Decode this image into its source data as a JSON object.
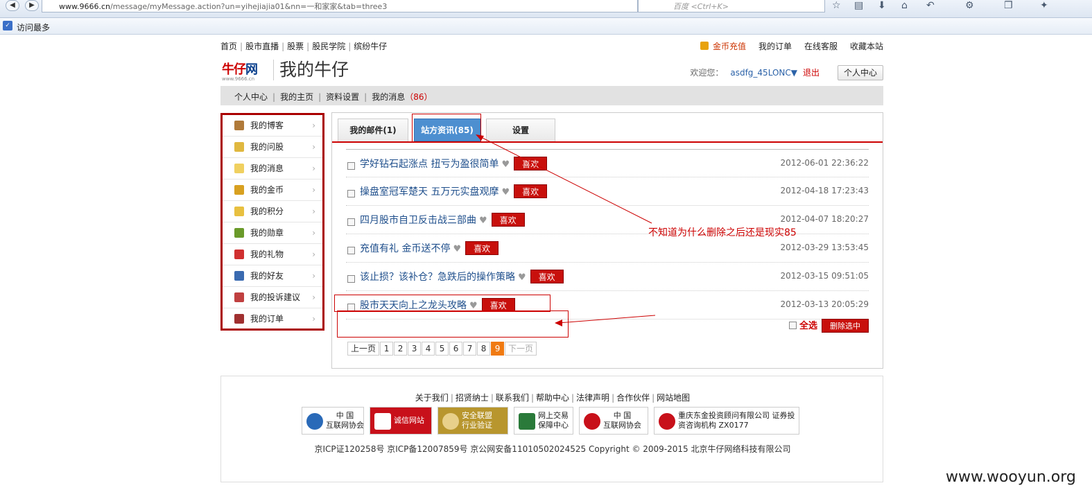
{
  "browser": {
    "url_host": "www.9666.cn",
    "url_rest": "/message/myMessage.action?un=yihejiajia01&nn=一和家家&tab=three3",
    "search_placeholder": "百度 <Ctrl+K>",
    "bookmark": "访问最多"
  },
  "topnav": {
    "left": [
      "首页",
      "股市直播",
      "股票",
      "股民学院",
      "缤纷牛仔"
    ],
    "right": {
      "coin": "金币充值",
      "orders": "我的订单",
      "service": "在线客服",
      "fav": "收藏本站"
    }
  },
  "header": {
    "logo_text_a": "牛仔",
    "logo_text_b": "网",
    "logo_url": "www.9666.cn",
    "title": "我的牛仔",
    "welcome": "欢迎您：",
    "user": "asdfg_45LONC▼",
    "logout": "退出",
    "center_btn": "个人中心"
  },
  "subnav": {
    "items": [
      "个人中心",
      "我的主页",
      "资料设置",
      "我的消息"
    ],
    "msg_count": "（86）"
  },
  "sidebar": {
    "items": [
      {
        "label": "我的博客",
        "icon": "blog-icon",
        "color": "#b07a3a"
      },
      {
        "label": "我的问股",
        "icon": "question-icon",
        "color": "#e0b840"
      },
      {
        "label": "我的消息",
        "icon": "message-icon",
        "color": "#f0d060"
      },
      {
        "label": "我的金币",
        "icon": "coins-icon",
        "color": "#d8a020"
      },
      {
        "label": "我的积分",
        "icon": "points-icon",
        "color": "#e8c040"
      },
      {
        "label": "我的勋章",
        "icon": "medal-icon",
        "color": "#6a9a2a"
      },
      {
        "label": "我的礼物",
        "icon": "gift-icon",
        "color": "#d03030"
      },
      {
        "label": "我的好友",
        "icon": "friends-icon",
        "color": "#3a6ab0"
      },
      {
        "label": "我的投诉建议",
        "icon": "complaint-icon",
        "color": "#c04040"
      },
      {
        "label": "我的订单",
        "icon": "order-icon",
        "color": "#a03030"
      }
    ]
  },
  "tabs": [
    {
      "label": "我的邮件(1)"
    },
    {
      "label": "站方资讯(85)"
    },
    {
      "label": "设置"
    }
  ],
  "messages": [
    {
      "title": "学好钻石起涨点 扭亏为盈很简单",
      "date": "2012-06-01 22:36:22"
    },
    {
      "title": "操盘室冠军楚天 五万元实盘观摩",
      "date": "2012-04-18 17:23:43"
    },
    {
      "title": "四月股市自卫反击战三部曲",
      "date": "2012-04-07 18:20:27"
    },
    {
      "title": "充值有礼 金币送不停",
      "date": "2012-03-29 13:53:45"
    },
    {
      "title": "该止损？该补仓？急跌后的操作策略",
      "date": "2012-03-15 09:51:05"
    },
    {
      "title": "股市天天向上之龙头攻略",
      "date": "2012-03-13 20:05:29"
    }
  ],
  "like_label": "喜欢",
  "select_all": "全选",
  "delete_selected": "删除选中",
  "pager": {
    "prev": "上一页",
    "pages": [
      "1",
      "2",
      "3",
      "4",
      "5",
      "6",
      "7",
      "8",
      "9"
    ],
    "current": "9",
    "next": "下一页"
  },
  "annotation": "不知道为什么删除之后还是现实85",
  "footer": {
    "links": [
      "关于我们",
      "招贤纳士",
      "联系我们",
      "帮助中心",
      "法律声明",
      "合作伙伴",
      "网站地图"
    ],
    "badges": [
      {
        "text": "中 国\n互联网协会"
      },
      {
        "text": "诚信网站"
      },
      {
        "text": "安全联盟\n行业验证"
      },
      {
        "text": "网上交易\n保障中心"
      },
      {
        "text": "中 国\n互联网协会"
      },
      {
        "text": "重庆东金投资顾问有限公司\n证券投资咨询机构 ZX0177"
      }
    ],
    "copyright": "京ICP证120258号 京ICP备12007859号 京公网安备11010502024525 Copyright © 2009-2015 北京牛仔网络科技有限公司"
  },
  "watermark": "www.wooyun.org"
}
